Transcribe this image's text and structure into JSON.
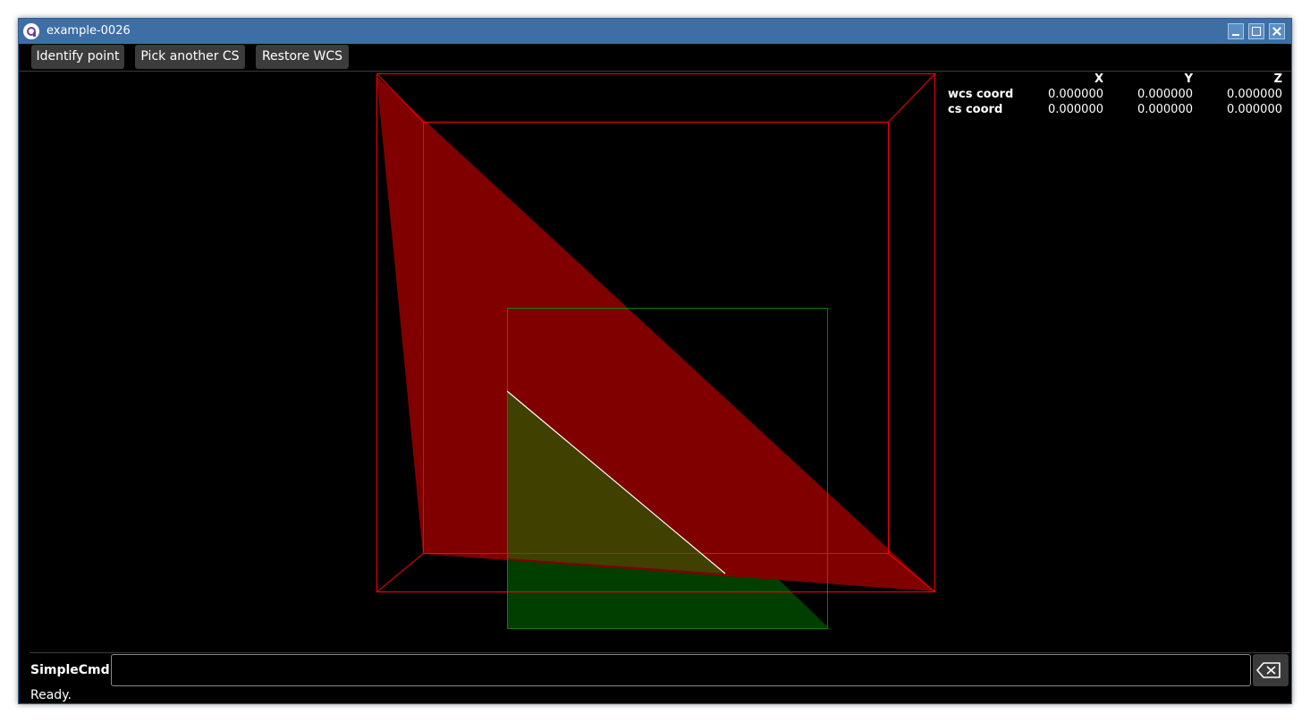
{
  "window": {
    "title": "example-0026"
  },
  "toolbar": {
    "identify_point": "Identify point",
    "pick_another_cs": "Pick another CS",
    "restore_wcs": "Restore WCS"
  },
  "coords": {
    "headers": [
      "X",
      "Y",
      "Z"
    ],
    "rows": [
      {
        "label": "wcs coord",
        "x": "0.000000",
        "y": "0.000000",
        "z": "0.000000"
      },
      {
        "label": "cs coord",
        "x": "0.000000",
        "y": "0.000000",
        "z": "0.000000"
      }
    ]
  },
  "command": {
    "label": "SimpleCmd",
    "value": "",
    "placeholder": ""
  },
  "status": {
    "text": "Ready."
  },
  "colors": {
    "title_bar": "#3d6fa6",
    "red_face": "#800000",
    "red_edge": "#ff0000",
    "green_face": "#003f00",
    "green_edge": "#00a000",
    "overlap": "#404000",
    "highlight": "#ffffff"
  }
}
